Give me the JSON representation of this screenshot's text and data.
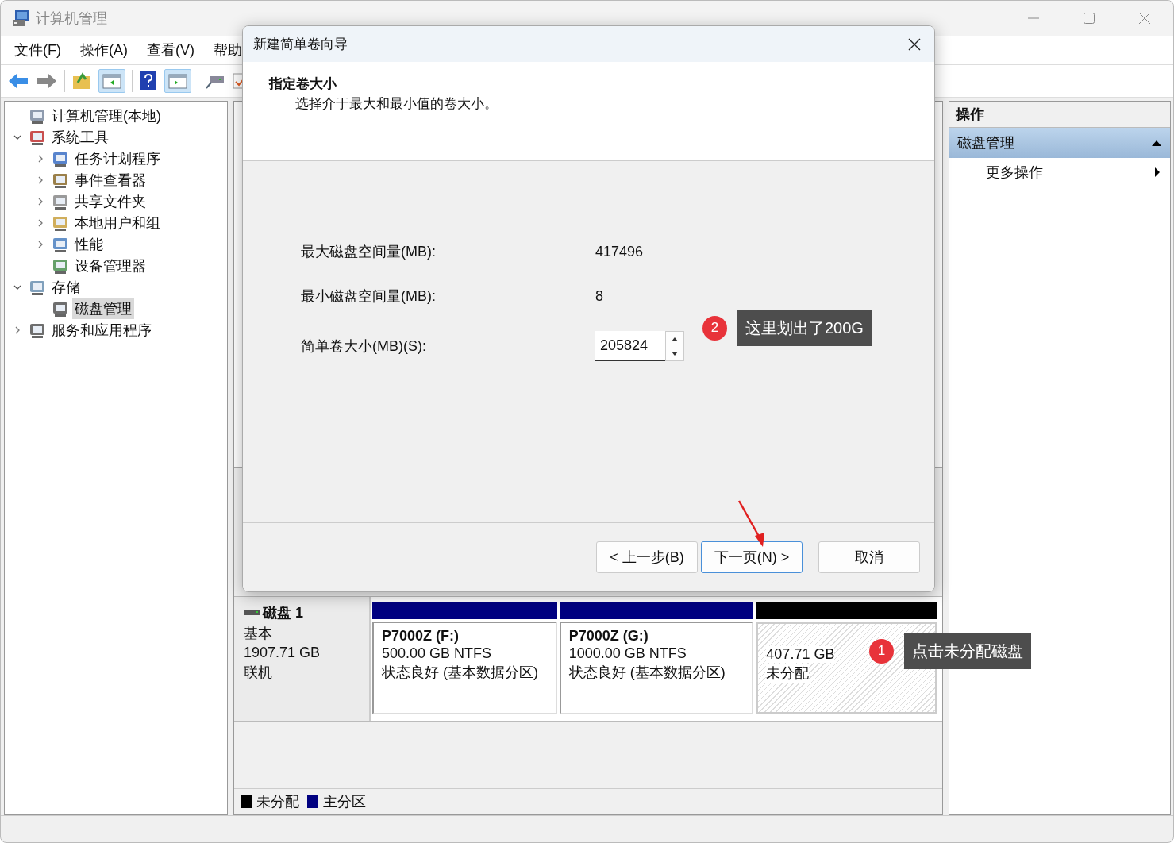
{
  "window": {
    "title": "计算机管理"
  },
  "menu": [
    {
      "label": "文件(F)"
    },
    {
      "label": "操作(A)"
    },
    {
      "label": "查看(V)"
    },
    {
      "label": "帮助"
    }
  ],
  "tree": [
    {
      "label": "计算机管理(本地)",
      "selected": false,
      "children": [
        {
          "label": "系统工具",
          "selected": false,
          "expanded": true,
          "children": [
            {
              "label": "任务计划程序",
              "selected": false,
              "expanded": false
            },
            {
              "label": "事件查看器",
              "selected": false,
              "expanded": false
            },
            {
              "label": "共享文件夹",
              "selected": false,
              "expanded": false
            },
            {
              "label": "本地用户和组",
              "selected": false,
              "expanded": false
            },
            {
              "label": "性能",
              "selected": false,
              "expanded": false
            },
            {
              "label": "设备管理器",
              "selected": false
            }
          ]
        },
        {
          "label": "存储",
          "selected": false,
          "expanded": true,
          "children": [
            {
              "label": "磁盘管理",
              "selected": true
            }
          ]
        },
        {
          "label": "服务和应用程序",
          "selected": false,
          "expanded": false
        }
      ]
    }
  ],
  "disk": {
    "name": "磁盘 1",
    "type": "基本",
    "size": "1907.71 GB",
    "status": "联机",
    "partitions": [
      {
        "kind": "primary",
        "name": "P7000Z  (F:)",
        "size": "500.00 GB NTFS",
        "status": "状态良好 (基本数据分区)"
      },
      {
        "kind": "primary",
        "name": "P7000Z  (G:)",
        "size": "1000.00 GB NTFS",
        "status": "状态良好 (基本数据分区)"
      },
      {
        "kind": "unallocated",
        "size": "407.71 GB",
        "status": "未分配"
      }
    ]
  },
  "legend": [
    {
      "label": "未分配",
      "color": "#000000"
    },
    {
      "label": "主分区",
      "color": "#000080"
    }
  ],
  "actions": {
    "title": "操作",
    "section": {
      "label": "磁盘管理",
      "expanded": true
    },
    "items": [
      {
        "label": "更多操作"
      }
    ]
  },
  "dialog": {
    "title": "新建简单卷向导",
    "heading": "指定卷大小",
    "subtitle": "选择介于最大和最小值的卷大小。",
    "fields": [
      {
        "label": "最大磁盘空间量(MB):",
        "value": "417496"
      },
      {
        "label": "最小磁盘空间量(MB):",
        "value": "8"
      }
    ],
    "size_field": {
      "label": "简单卷大小(MB)(S):",
      "value": "205824"
    },
    "buttons": [
      {
        "label": "< 上一步(B)",
        "default": false
      },
      {
        "label": "下一页(N) >",
        "default": true
      },
      {
        "label": "取消",
        "default": false
      }
    ]
  },
  "annotations": [
    {
      "number": "2",
      "text": "这里划出了200G"
    },
    {
      "number": "1",
      "text": "点击未分配磁盘"
    }
  ]
}
